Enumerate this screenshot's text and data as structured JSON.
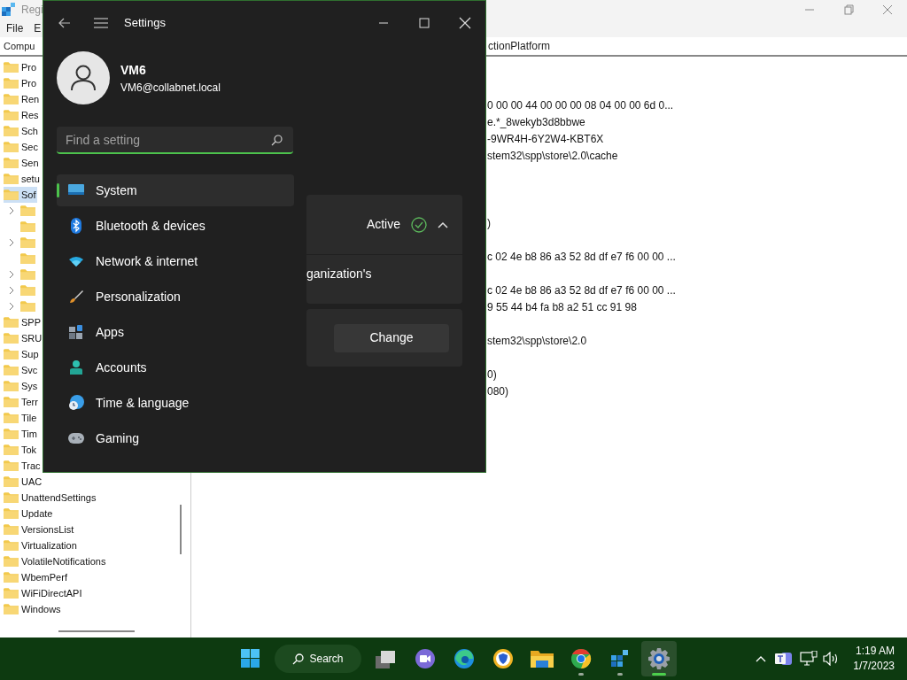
{
  "registry": {
    "title": "Regi",
    "menu": [
      "File",
      "E"
    ],
    "address_left": "Compu",
    "address_right": "ctionPlatform",
    "tree": [
      {
        "label": "Pro",
        "selected": false
      },
      {
        "label": "Pro",
        "selected": false
      },
      {
        "label": "Ren",
        "selected": false
      },
      {
        "label": "Res",
        "selected": false
      },
      {
        "label": "Sch",
        "selected": false
      },
      {
        "label": "Sec",
        "selected": false
      },
      {
        "label": "Sen",
        "selected": false
      },
      {
        "label": "setu",
        "selected": false
      },
      {
        "label": "Sof",
        "selected": true,
        "children": [
          {
            "expandable": true
          },
          {
            "expandable": false
          },
          {
            "expandable": true
          },
          {
            "expandable": false
          },
          {
            "expandable": true
          },
          {
            "expandable": true
          },
          {
            "expandable": true
          }
        ]
      },
      {
        "label": "SPP",
        "selected": false
      },
      {
        "label": "SRU",
        "selected": false
      },
      {
        "label": "Sup",
        "selected": false
      },
      {
        "label": "Svc",
        "selected": false
      },
      {
        "label": "Sys",
        "selected": false
      },
      {
        "label": "Terr",
        "selected": false
      },
      {
        "label": "Tile",
        "selected": false
      },
      {
        "label": "Tim",
        "selected": false
      },
      {
        "label": "Tok",
        "selected": false
      },
      {
        "label": "Trac",
        "selected": false
      },
      {
        "label": "UAC",
        "selected": false
      },
      {
        "label": "UnattendSettings",
        "selected": false
      },
      {
        "label": "Update",
        "selected": false
      },
      {
        "label": "VersionsList",
        "selected": false
      },
      {
        "label": "Virtualization",
        "selected": false
      },
      {
        "label": "VolatileNotifications",
        "selected": false
      },
      {
        "label": "WbemPerf",
        "selected": false
      },
      {
        "label": "WiFiDirectAPI",
        "selected": false
      },
      {
        "label": "Windows",
        "selected": false
      }
    ],
    "value_rows": [
      "0 00 00 44 00 00 00 08 04 00 00 6d 0...",
      "e.*_8wekyb3d8bbwe",
      "-9WR4H-6Y2W4-KBT6X",
      "stem32\\spp\\store\\2.0\\cache",
      null,
      null,
      null,
      ")",
      null,
      "c 02 4e b8 86 a3 52 8d df e7 f6 00 00 ...",
      null,
      "c 02 4e b8 86 a3 52 8d df e7 f6 00 00 ...",
      "9 55 44 b4 fa b8 a2 51 cc 91 98",
      null,
      "stem32\\spp\\store\\2.0",
      null,
      "0)",
      "080)"
    ]
  },
  "settings": {
    "title": "Settings",
    "user_name": "VM6",
    "user_email": "VM6@collabnet.local",
    "search": {
      "placeholder": "Find a setting"
    },
    "nav": [
      {
        "label": "System",
        "kind": "system",
        "selected": true
      },
      {
        "label": "Bluetooth & devices",
        "kind": "bluetooth",
        "selected": false
      },
      {
        "label": "Network & internet",
        "kind": "network",
        "selected": false
      },
      {
        "label": "Personalization",
        "kind": "brush",
        "selected": false
      },
      {
        "label": "Apps",
        "kind": "apps",
        "selected": false
      },
      {
        "label": "Accounts",
        "kind": "accounts",
        "selected": false
      },
      {
        "label": "Time & language",
        "kind": "time",
        "selected": false
      },
      {
        "label": "Gaming",
        "kind": "gaming",
        "selected": false
      }
    ],
    "status_card": {
      "status": "Active",
      "expanded": true
    },
    "detail_text": "ganization's",
    "change_button": "Change"
  },
  "taskbar": {
    "search_label": "Search",
    "apps": [
      {
        "kind": "taskview",
        "running": false,
        "active": false
      },
      {
        "kind": "meet",
        "running": false,
        "active": false
      },
      {
        "kind": "edge",
        "running": false,
        "active": false
      },
      {
        "kind": "shield",
        "running": false,
        "active": false
      },
      {
        "kind": "folder",
        "running": false,
        "active": false
      },
      {
        "kind": "chrome",
        "running": true,
        "active": false
      },
      {
        "kind": "registry",
        "running": true,
        "active": false
      },
      {
        "kind": "settings",
        "running": true,
        "active": true
      }
    ],
    "time": "1:19 AM",
    "date": "1/7/2023"
  }
}
